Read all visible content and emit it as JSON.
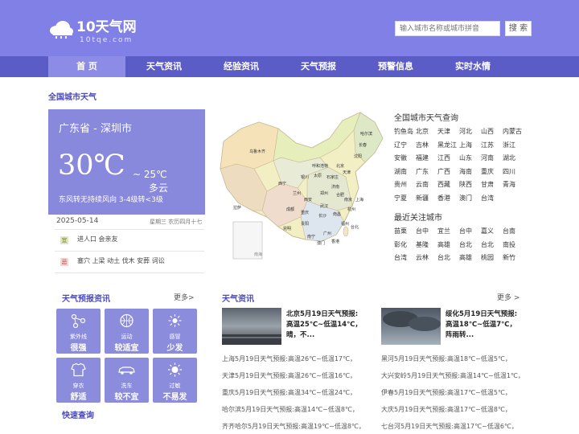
{
  "site": {
    "name": "10天气网",
    "domain": "10tqe.com"
  },
  "search": {
    "placeholder": "输入城市名称或城市拼音",
    "button": "搜 索"
  },
  "nav": [
    "首 页",
    "天气资讯",
    "经验资讯",
    "天气预报",
    "预警信息",
    "实时水情"
  ],
  "section_national": "全国城市天气",
  "current": {
    "location": "广东省 - 深圳市",
    "temp": "30℃",
    "low": "~ 25℃",
    "condition": "多云",
    "wind": "东风转无持续风向 3-4级转<3级",
    "date": "2025-05-14",
    "weekday": "星期三 农历四月十七"
  },
  "almanac": [
    {
      "icon": "宜",
      "text": "进人口 会亲友"
    },
    {
      "icon": "忌",
      "text": "塞穴 上梁 动土 伐木 安葬 词讼"
    }
  ],
  "query_title": "全国城市天气查询",
  "query_cities": [
    "钓鱼岛",
    "北京",
    "天津",
    "河北",
    "山西",
    "内蒙古",
    "辽宁",
    "吉林",
    "黑龙江",
    "上海",
    "江苏",
    "浙江",
    "安徽",
    "福建",
    "江西",
    "山东",
    "河南",
    "湖北",
    "湖南",
    "广东",
    "广西",
    "海南",
    "重庆",
    "四川",
    "贵州",
    "云南",
    "西藏",
    "陕西",
    "甘肃",
    "青海",
    "宁夏",
    "新疆",
    "香港",
    "澳门",
    "台湾"
  ],
  "recent_title": "最近关注城市",
  "recent_cities": [
    "苗栗",
    "台中",
    "宜兰",
    "台中",
    "嘉义",
    "台南",
    "彰化",
    "基隆",
    "高雄",
    "台北",
    "台北",
    "南投",
    "台湾",
    "云林",
    "台北",
    "高雄",
    "桃园",
    "新竹"
  ],
  "map_labels": [
    "乌鲁木齐",
    "呼和浩特",
    "拉萨",
    "西宁",
    "兰州",
    "银川",
    "太原",
    "石家庄",
    "北京",
    "天津",
    "济南",
    "郑州",
    "西安",
    "成都",
    "重庆",
    "武汉",
    "合肥",
    "南京",
    "上海",
    "杭州",
    "长沙",
    "南昌",
    "福州",
    "贵阳",
    "昆明",
    "南宁",
    "广州",
    "台北",
    "沈阳",
    "长春",
    "哈尔滨",
    "澳门",
    "香港"
  ],
  "forecast_title": "天气预报资讯",
  "forecast_more": "更多>",
  "tiles": [
    {
      "icon": "molecule-icon",
      "label": "紫外线",
      "value": "很强"
    },
    {
      "icon": "ball-icon",
      "label": "运动",
      "value": "较适宜"
    },
    {
      "icon": "sun-star-icon",
      "label": "感冒",
      "value": "少发"
    },
    {
      "icon": "shirt-icon",
      "label": "穿衣",
      "value": "舒适"
    },
    {
      "icon": "car-icon",
      "label": "洗车",
      "value": "较不宜"
    },
    {
      "icon": "sun-icon",
      "label": "过敏",
      "value": "不易发"
    }
  ],
  "quick_query": "快速查询",
  "news_title": "天气资讯",
  "news_more": "更多 >",
  "news_feature": [
    {
      "title": "北京5月19日天气预报:高温25℃~低温14℃，晴，不..."
    },
    {
      "title": "绥化5月19日天气预报:高温18℃~低温7℃，阵雨转..."
    }
  ],
  "news_left": [
    "上海5月19日天气预报:高温26℃~低温17℃，",
    "天津5月19日天气预报:高温26℃~低温16℃，",
    "重庆5月19日天气预报:高温34℃~低温24℃，",
    "哈尔滨5月19日天气预报:高温14℃~低温8℃，",
    "齐齐哈尔5月19日天气预报:高温19℃~低温8℃，"
  ],
  "news_right": [
    "黑河5月19日天气预报:高温18℃~低温5℃，",
    "大兴安岭5月19日天气预报:高温14℃~低温1℃，",
    "伊春5月19日天气预报:高温17℃~低温5℃，",
    "大庆5月19日天气预报:高温17℃~低温8℃，",
    "七台河5月19日天气预报:高温17℃~低温6℃，"
  ]
}
